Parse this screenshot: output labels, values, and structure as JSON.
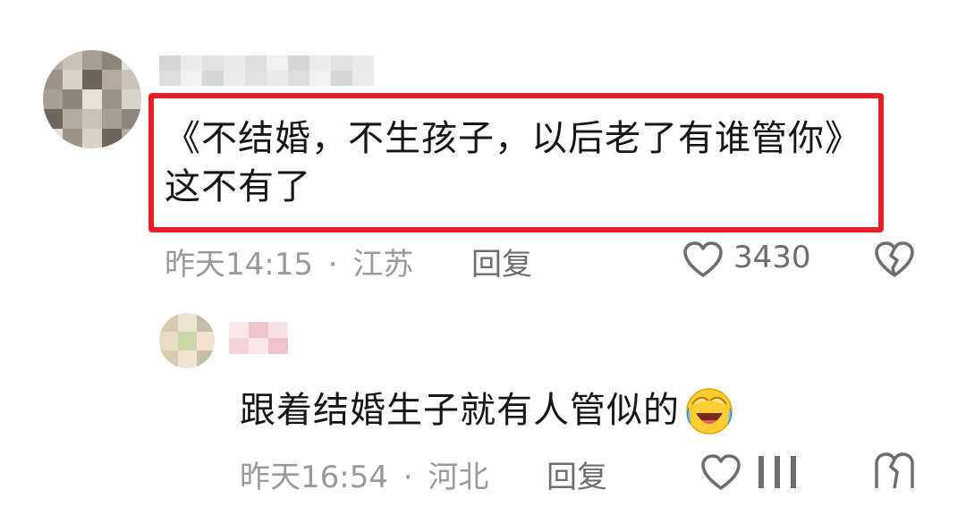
{
  "comments": [
    {
      "text": "《不结婚，不生孩子，以后老了有谁管你》这不有了",
      "time": "昨天14:15",
      "location": "江苏",
      "reply_label": "回复",
      "likes": "3430"
    },
    {
      "text": "跟着结婚生子就有人管似的",
      "emoji": "laughing-crying-emoji",
      "time": "昨天16:54",
      "location": "河北",
      "reply_label": "回复"
    }
  ],
  "separator": "·",
  "colors": {
    "highlight_border": "#e3202a",
    "meta_text": "#9a9a9a",
    "icon_stroke": "#6d6d6d"
  }
}
